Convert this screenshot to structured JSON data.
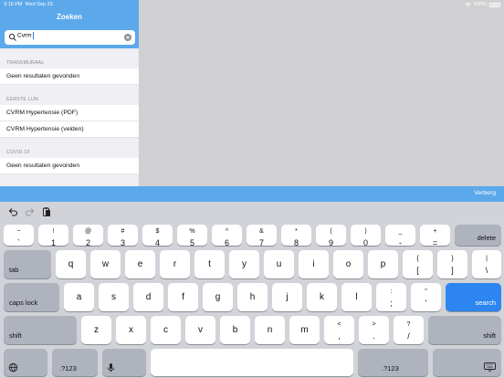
{
  "status": {
    "time": "3:16 PM",
    "date": "Wed Sep 23",
    "battery": "100%"
  },
  "sidebar": {
    "title": "Zoeken",
    "search_value": "Cvrm",
    "sections": [
      {
        "header": "TRANSMURAAL",
        "rows": [
          "Geen resultaten gevonden"
        ]
      },
      {
        "header": "EERSTE LIJN",
        "rows": [
          "CVRM Hypertensie (PDF)",
          "CVRM Hypertensie (velden)"
        ]
      },
      {
        "header": "COVID-19",
        "rows": [
          "Geen resultaten gevonden"
        ]
      }
    ]
  },
  "accessory": {
    "hide_label": "Verberg"
  },
  "toolbar": {
    "icons": [
      "undo-icon",
      "redo-icon",
      "paste-icon"
    ]
  },
  "keyboard": {
    "row1": [
      {
        "top": "~",
        "bottom": "`"
      },
      {
        "top": "!",
        "bottom": "1"
      },
      {
        "top": "@",
        "bottom": "2"
      },
      {
        "top": "#",
        "bottom": "3"
      },
      {
        "top": "$",
        "bottom": "4"
      },
      {
        "top": "%",
        "bottom": "5"
      },
      {
        "top": "^",
        "bottom": "6"
      },
      {
        "top": "&",
        "bottom": "7"
      },
      {
        "top": "*",
        "bottom": "8"
      },
      {
        "top": "(",
        "bottom": "9"
      },
      {
        "top": ")",
        "bottom": "0"
      },
      {
        "top": "_",
        "bottom": "-"
      },
      {
        "top": "+",
        "bottom": "="
      }
    ],
    "delete": "delete",
    "tab": "tab",
    "row2": [
      "q",
      "w",
      "e",
      "r",
      "t",
      "y",
      "u",
      "i",
      "o",
      "p"
    ],
    "row2_extra": [
      {
        "top": "{",
        "bottom": "["
      },
      {
        "top": "}",
        "bottom": "]"
      },
      {
        "top": "|",
        "bottom": "\\"
      }
    ],
    "caps": "caps lock",
    "row3": [
      "a",
      "s",
      "d",
      "f",
      "g",
      "h",
      "j",
      "k",
      "l"
    ],
    "row3_extra": [
      {
        "top": ":",
        "bottom": ";"
      },
      {
        "top": "\"",
        "bottom": "'"
      }
    ],
    "search": "search",
    "shift": "shift",
    "row4": [
      "z",
      "x",
      "c",
      "v",
      "b",
      "n",
      "m"
    ],
    "row4_extra": [
      {
        "top": "<",
        "bottom": ","
      },
      {
        "top": ">",
        "bottom": "."
      },
      {
        "top": "?",
        "bottom": "/"
      }
    ],
    "numbers": ".?123",
    "colors": {
      "accent": "#5ba8eb",
      "search_key": "#2c85f0",
      "key": "#ffffff",
      "dark_key": "#aeb3bd",
      "background": "#d1d3d9"
    }
  }
}
